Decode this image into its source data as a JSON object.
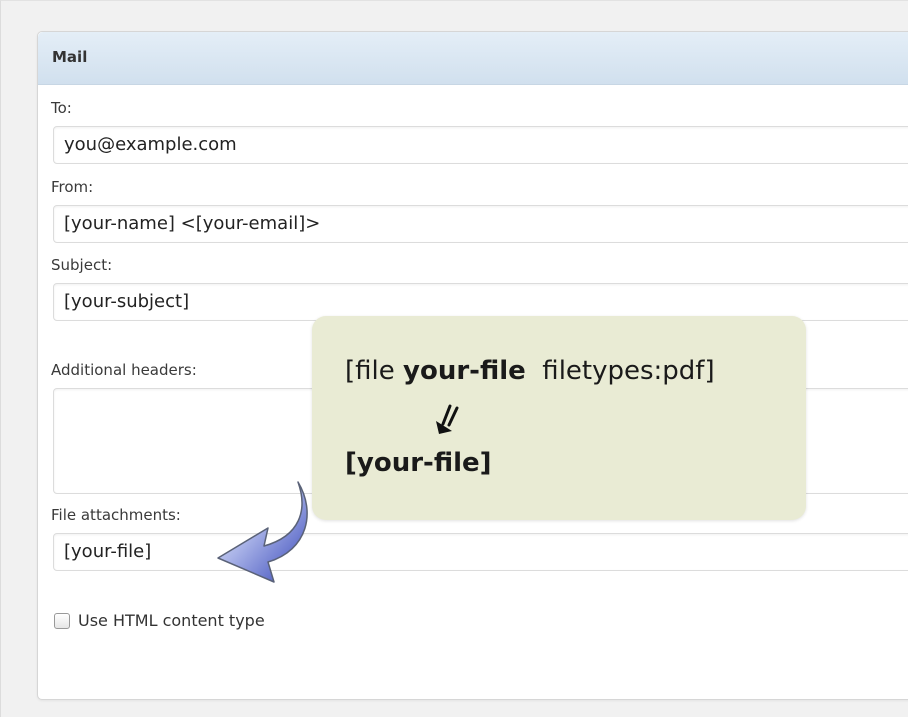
{
  "panel": {
    "title": "Mail"
  },
  "fields": {
    "to": {
      "label": "To:",
      "value": "you@example.com"
    },
    "from": {
      "label": "From:",
      "value": "[your-name] <[your-email]>"
    },
    "subject": {
      "label": "Subject:",
      "value": "[your-subject]"
    },
    "additional_headers": {
      "label": "Additional headers:",
      "value": ""
    },
    "file_attachments": {
      "label": "File attachments:",
      "value": "[your-file]"
    }
  },
  "options": {
    "html_content_type_label": "Use HTML content type",
    "html_content_type_checked": false
  },
  "callout": {
    "line1_prefix": "[file ",
    "line1_bold": "your-file",
    "line1_suffix": "  filetypes:pdf]",
    "arrow_icon": "double-arrow-down-icon",
    "line2": "[your-file]"
  },
  "colors": {
    "callout_background": "#e9ebd4",
    "arrow_blue": "#3b4fc0",
    "header_background": "#dbe7f2"
  }
}
